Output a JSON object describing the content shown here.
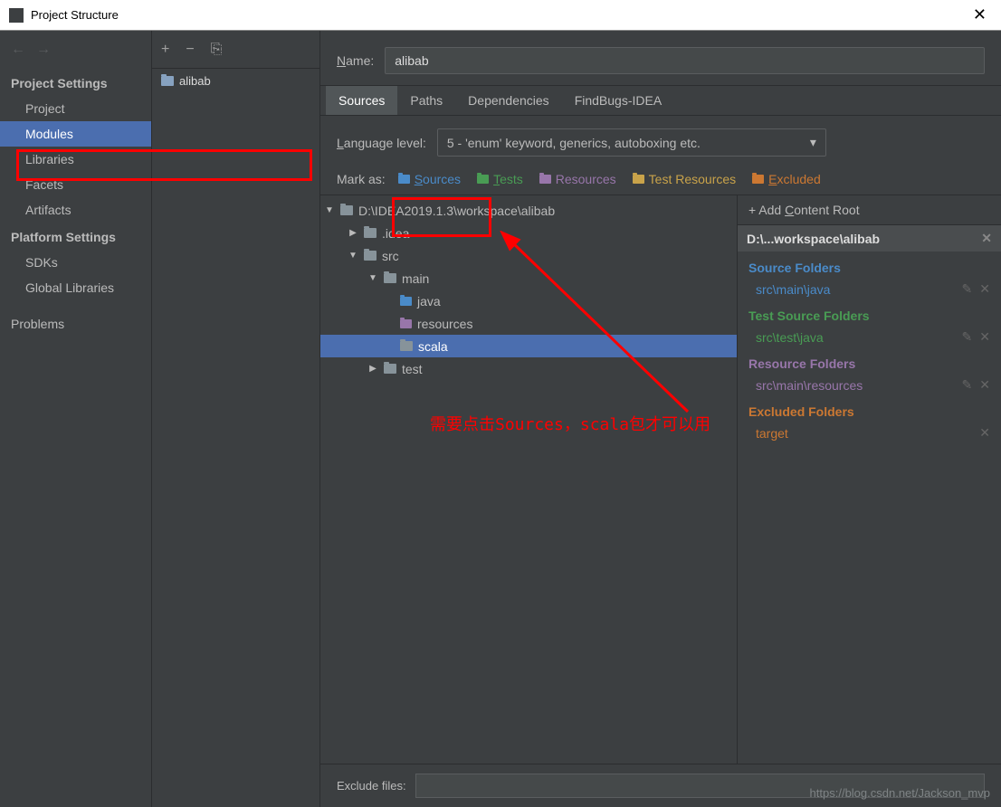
{
  "window": {
    "title": "Project Structure"
  },
  "sidebar": {
    "projectSettings": "Project Settings",
    "items": [
      "Project",
      "Modules",
      "Libraries",
      "Facets",
      "Artifacts"
    ],
    "platformSettings": "Platform Settings",
    "platformItems": [
      "SDKs",
      "Global Libraries"
    ],
    "problems": "Problems"
  },
  "moduleList": {
    "module": "alibab"
  },
  "detail": {
    "nameLabel": "Name:",
    "nameValue": "alibab",
    "tabs": [
      "Sources",
      "Paths",
      "Dependencies",
      "FindBugs-IDEA"
    ],
    "langLabel": "Language level:",
    "langValue": "5 - 'enum' keyword, generics, autoboxing etc.",
    "markAs": "Mark as:",
    "marks": {
      "sources": "Sources",
      "tests": "Tests",
      "resources": "Resources",
      "testResources": "Test Resources",
      "excluded": "Excluded"
    },
    "excludeLabel": "Exclude files:"
  },
  "tree": {
    "root": "D:\\IDEA2019.1.3\\workspace\\alibab",
    "idea": ".idea",
    "src": "src",
    "main": "main",
    "java": "java",
    "resources": "resources",
    "scala": "scala",
    "test": "test"
  },
  "contentRoot": {
    "add": "Add Content Root",
    "path": "D:\\...workspace\\alibab",
    "sourceFolders": "Source Folders",
    "sourcePath": "src\\main\\java",
    "testFolders": "Test Source Folders",
    "testPath": "src\\test\\java",
    "resourceFolders": "Resource Folders",
    "resourcePath": "src\\main\\resources",
    "excludedFolders": "Excluded Folders",
    "excludedPath": "target"
  },
  "annotation": "需要点击Sources，scala包才可以用",
  "watermark": "https://blog.csdn.net/Jackson_mvp"
}
